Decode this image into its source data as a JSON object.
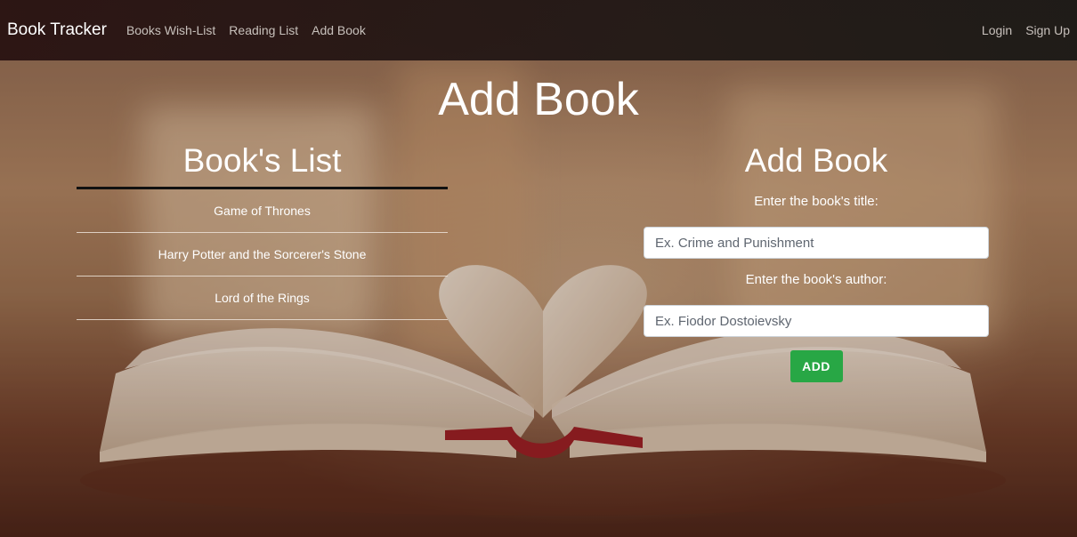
{
  "navbar": {
    "brand": "Book Tracker",
    "links": [
      "Books Wish-List",
      "Reading List",
      "Add Book"
    ],
    "login": "Login",
    "signup": "Sign Up"
  },
  "main": {
    "title": "Add Book"
  },
  "book_list": {
    "heading": "Book's List",
    "items": [
      "Game of Thrones",
      "Harry Potter and the Sorcerer's Stone",
      "Lord of the Rings"
    ]
  },
  "form": {
    "heading": "Add Book",
    "title_label": "Enter the book's title:",
    "title_placeholder": "Ex. Crime and Punishment",
    "author_label": "Enter the book's author:",
    "author_placeholder": "Ex. Fiodor Dostoievsky",
    "submit_label": "ADD"
  },
  "colors": {
    "accent_button": "#28a745",
    "navbar_bg": "#2a1a18"
  }
}
